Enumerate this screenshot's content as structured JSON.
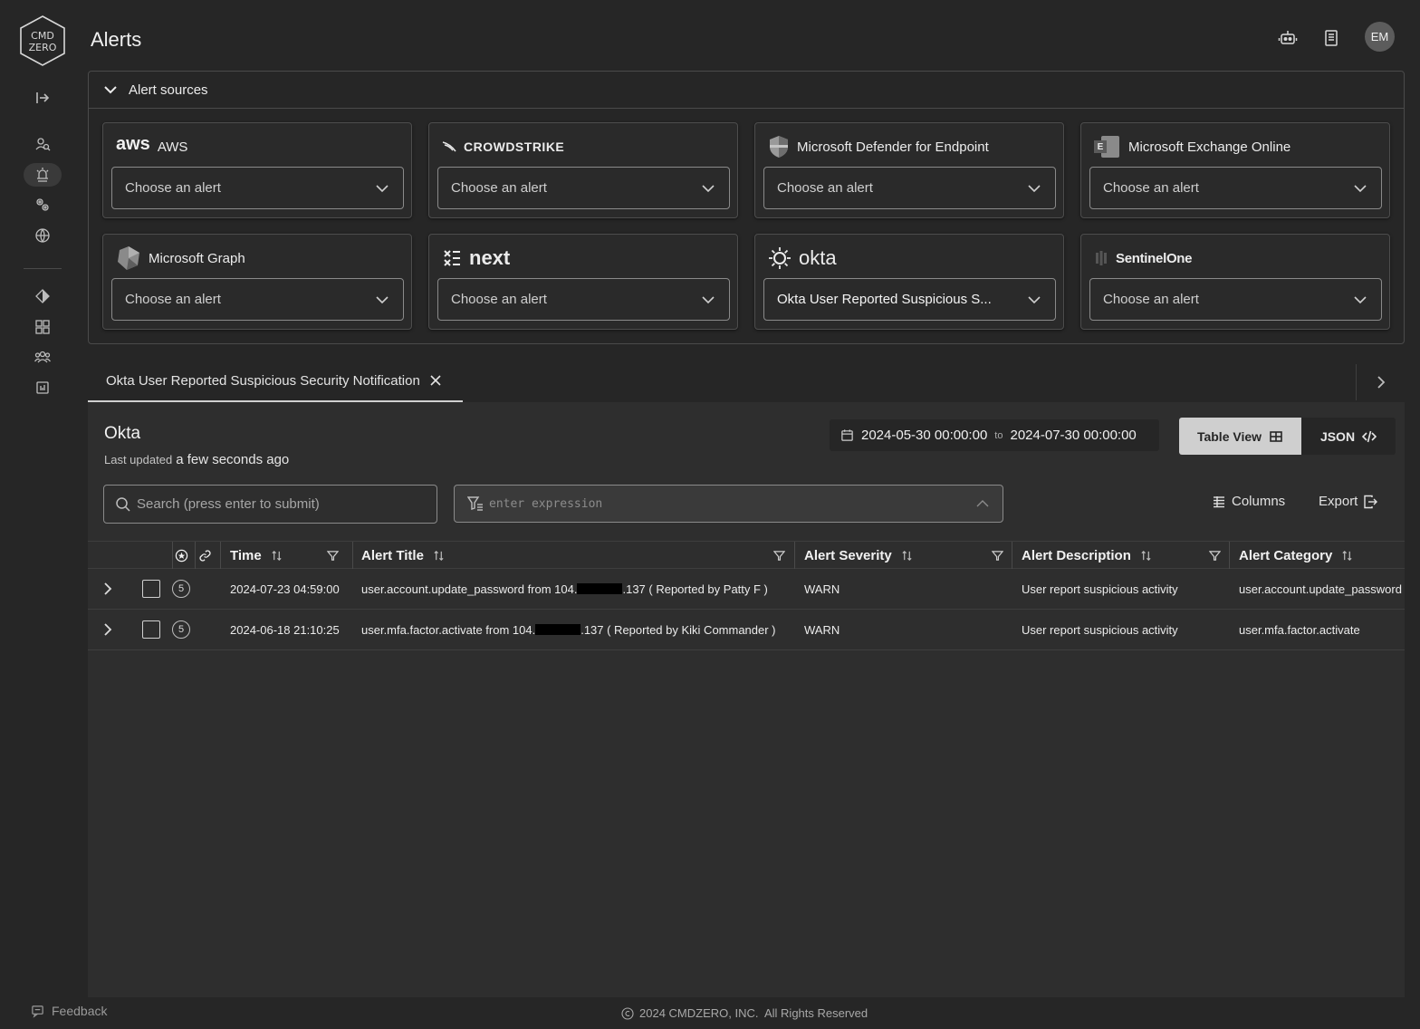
{
  "header": {
    "title": "Alerts",
    "avatar_initials": "EM"
  },
  "icons": {
    "robot": "robot-icon",
    "docs": "book-icon"
  },
  "sources": {
    "section_label": "Alert sources",
    "cards": [
      {
        "name": "AWS",
        "logo_text": "aws",
        "value": "Choose an alert"
      },
      {
        "name": "",
        "logo_text": "CROWDSTRIKE",
        "value": "Choose an alert"
      },
      {
        "name": "Microsoft Defender for Endpoint",
        "logo_text": "",
        "value": "Choose an alert"
      },
      {
        "name": "Microsoft Exchange Online",
        "logo_text": "E",
        "value": "Choose an alert"
      },
      {
        "name": "Microsoft Graph",
        "logo_text": "",
        "value": "Choose an alert"
      },
      {
        "name": "",
        "logo_text": "next",
        "value": "Choose an alert"
      },
      {
        "name": "",
        "logo_text": "okta",
        "value": "Okta User Reported Suspicious S..."
      },
      {
        "name": "",
        "logo_text": "SentinelOne",
        "value": "Choose an alert"
      }
    ]
  },
  "tab": {
    "label": "Okta User Reported Suspicious Security Notification"
  },
  "panel": {
    "title": "Okta",
    "updated_prefix": "Last updated",
    "updated_value": "a few seconds ago",
    "date_from": "2024-05-30 00:00:00",
    "date_to_label": "to",
    "date_to": "2024-07-30 00:00:00",
    "table_view_label": "Table View",
    "json_label": "JSON",
    "search_placeholder": "Search (press enter to submit)",
    "expression_placeholder": "enter expression",
    "columns_label": "Columns",
    "export_label": "Export"
  },
  "table": {
    "headers": [
      "Time",
      "Alert Title",
      "Alert Severity",
      "Alert Description",
      "Alert Category"
    ],
    "rows": [
      {
        "count": "5",
        "time": "2024-07-23 04:59:00",
        "title_pre": "user.account.update_password from 104.",
        "title_post": ".137 ( Reported by Patty F )",
        "severity": "WARN",
        "description": "User report suspicious activity",
        "category": "user.account.update_password"
      },
      {
        "count": "5",
        "time": "2024-06-18 21:10:25",
        "title_pre": "user.mfa.factor.activate from 104.",
        "title_post": ".137 ( Reported by Kiki Commander )",
        "severity": "WARN",
        "description": "User report suspicious activity",
        "category": "user.mfa.factor.activate"
      }
    ]
  },
  "footer": {
    "text": "2024 CMDZERO, INC.  All Rights Reserved",
    "feedback": "Feedback"
  }
}
